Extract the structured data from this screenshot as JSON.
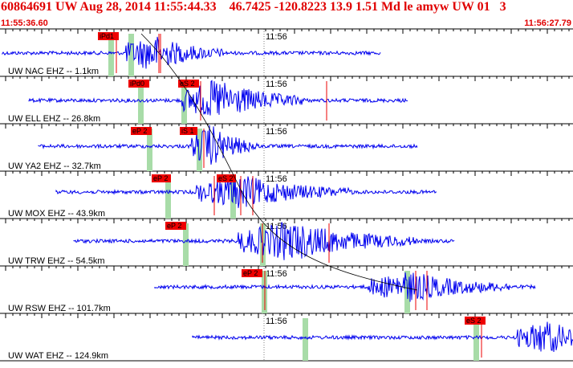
{
  "header": {
    "title": "60864691 UW Aug 28, 2014 11:55:44.33    46.7425 -120.8223 13.9 1.51 Md le amyw UW 01   3",
    "start_time": "11:55:36.60",
    "end_time": "11:56:27.79"
  },
  "colors": {
    "header_text": "#e00000",
    "trace": "#0000ee",
    "pick_box": "#ee0000",
    "pick_window": "#a8dca8",
    "grid": "#000000"
  },
  "time_label": "11:56",
  "traces": [
    {
      "label": "UW NAC EHZ -- 1.1km",
      "picks": [
        "iPd1"
      ]
    },
    {
      "label": "UW ELL EHZ -- 26.8km",
      "picks": [
        "iPd0",
        "eS 2"
      ]
    },
    {
      "label": "UW YA2 EHZ -- 32.7km",
      "picks": [
        "eP 2",
        "iS 1"
      ]
    },
    {
      "label": "UW MOX EHZ -- 43.9km",
      "picks": [
        "eP 2",
        "eS 2"
      ]
    },
    {
      "label": "UW TRW EHZ -- 54.5km",
      "picks": [
        "eP 2"
      ]
    },
    {
      "label": "UW RSW EHZ -- 101.7km",
      "picks": [
        "eP 2"
      ]
    },
    {
      "label": "UW WAT EHZ -- 124.9km",
      "picks": [
        "eS 2"
      ]
    }
  ]
}
